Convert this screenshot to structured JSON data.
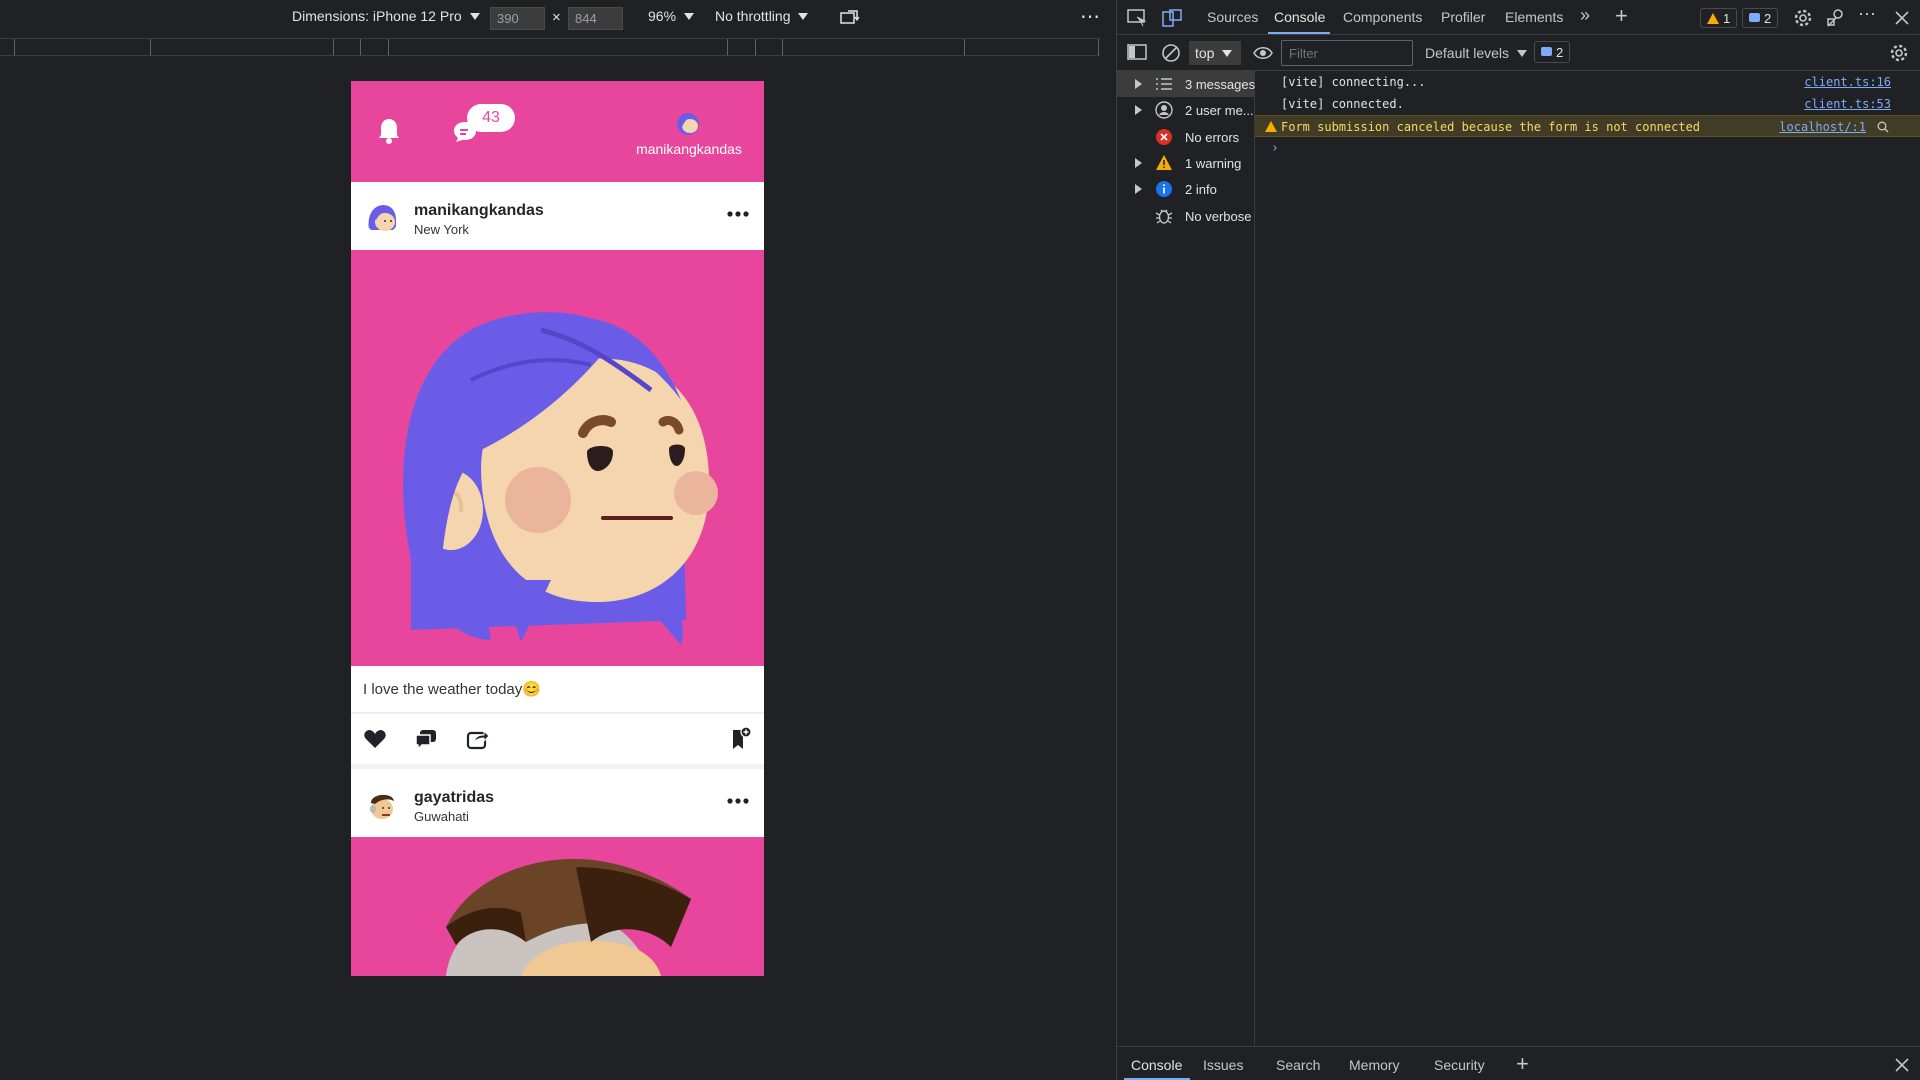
{
  "emulation": {
    "dimensions_label": "Dimensions: iPhone 12 Pro",
    "width_value": "390",
    "height_value": "844",
    "times": "×",
    "zoom": "96%",
    "throttling": "No throttling",
    "more": "⋯"
  },
  "app": {
    "message_count": "43",
    "header_username": "manikangkandas",
    "posts": [
      {
        "username": "manikangkandas",
        "location": "New York",
        "caption": "I love the weather today😊"
      },
      {
        "username": "gayatridas",
        "location": "Guwahati"
      }
    ],
    "colors": {
      "brand_pink": "#e8469d",
      "hair_purple": "#6b5ce7"
    }
  },
  "devtools": {
    "tabs": [
      "Sources",
      "Console",
      "Components",
      "Profiler",
      "Elements"
    ],
    "more_tabs": "»",
    "new_tab": "+",
    "warning_count": "1",
    "info_count": "2",
    "context": "top",
    "filter_placeholder": "Filter",
    "levels": "Default levels",
    "issues_count": "2",
    "sidebar": [
      {
        "label": "3 messages",
        "icon": "list-icon"
      },
      {
        "label": "2 user me...",
        "icon": "user-icon"
      },
      {
        "label": "No errors",
        "icon": "error-icon"
      },
      {
        "label": "1 warning",
        "icon": "warning-icon"
      },
      {
        "label": "2 info",
        "icon": "info-icon"
      },
      {
        "label": "No verbose",
        "icon": "bug-icon"
      }
    ],
    "logs": [
      {
        "text": "[vite] connecting...",
        "source": "client.ts:16"
      },
      {
        "text": "[vite] connected.",
        "source": "client.ts:53"
      },
      {
        "text": "Form submission canceled because the form is not connected",
        "source": "localhost/:1",
        "level": "warning"
      }
    ],
    "prompt": "›",
    "drawer_tabs": [
      "Console",
      "Issues",
      "Search",
      "Memory",
      "Security"
    ],
    "drawer_add": "+"
  }
}
